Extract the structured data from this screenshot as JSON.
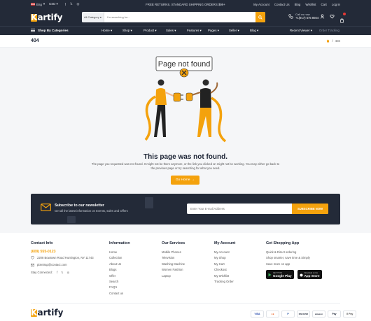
{
  "topbar": {
    "language": "Eng",
    "currency": "USD",
    "promo": "FREE RETURNS. STANDARD SHIPPING ORDERS $99+",
    "links": [
      "My Account",
      "Contact Us",
      "Blog",
      "Wishlist",
      "Cart",
      "Log In"
    ]
  },
  "brand": {
    "logo_initial": "K",
    "logo_rest": "artify"
  },
  "search": {
    "category": "All Category",
    "placeholder": "I'm searching for..."
  },
  "contact": {
    "label": "Call us now",
    "phone": "+1(917) 575 8944"
  },
  "nav": {
    "shop_by_categories": "Shop By Categories",
    "menu": [
      "Home",
      "Shop",
      "Product",
      "Sales",
      "Features",
      "Pages",
      "Seller",
      "Blog"
    ],
    "recent_viewer": "Recent Viewer",
    "order_tracking": "Order Tracking"
  },
  "breadcrumb": {
    "title": "404",
    "current": "404"
  },
  "error": {
    "bubble": "Page not found",
    "title": "This page was not found.",
    "description": "The page you requested was not found. It might not be there anymore, or the link you clicked on might not be working. You may either go back to the previous page or try searching for what you need.",
    "button": "Go Home"
  },
  "newsletter": {
    "title": "Subscribe to our newsletter",
    "subtitle": "Get all the latest information on Events, sales and Offers",
    "placeholder": "Enter Your E-mail Address",
    "button": "SUBSCRIBE NOW"
  },
  "footer": {
    "contact": {
      "heading": "Contact Info",
      "phone": "(609) 555-0123",
      "address": "2208 Bowtown Road Huntington, NY 11743",
      "email": "pixietrap@contact.com",
      "stay_connected": "Stay Connected :"
    },
    "columns": [
      {
        "heading": "Information",
        "items": [
          "Home",
          "Collection",
          "About Us",
          "Blogs",
          "Offer",
          "Search",
          "FAQ's",
          "Contact us"
        ]
      },
      {
        "heading": "Our Services",
        "items": [
          "Mobile Phones",
          "Television",
          "Washing Machine",
          "Women Fashion",
          "Laptop"
        ]
      },
      {
        "heading": "My Account",
        "items": [
          "My Account",
          "My Shop",
          "My Cart",
          "Checkout",
          "My Wishlist",
          "Tracking Order"
        ]
      }
    ],
    "app": {
      "heading": "Get Shopping App",
      "items": [
        "Quick & Direct ordering",
        "Shop smarter, save time & Simply",
        "Save more on app"
      ],
      "google_small": "GET IT ON",
      "google": "Google Play",
      "apple_small": "Download on the",
      "apple": "App Store"
    },
    "payments": [
      "VISA",
      "●●",
      "P",
      "DISCOVER",
      "amazon",
      "Pay",
      "G Pay"
    ]
  },
  "colors": {
    "accent": "#f4a20d",
    "dark": "#232a38",
    "bg": "#f5f6f8"
  }
}
